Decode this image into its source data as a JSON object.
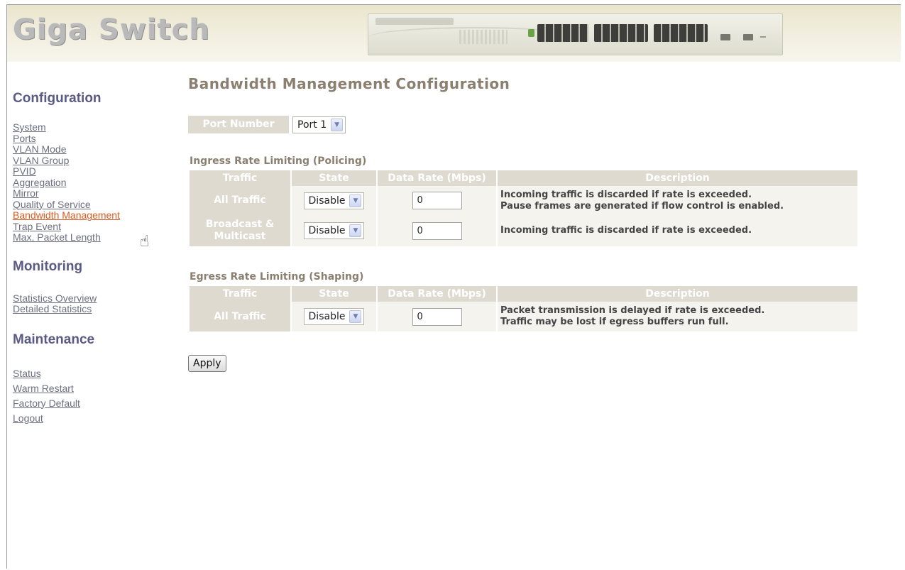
{
  "header": {
    "logo_text": "Giga Switch",
    "device_image": "switch-front-panel"
  },
  "sidebar": {
    "configuration": {
      "heading": "Configuration",
      "items": [
        "System",
        "Ports",
        "VLAN Mode",
        "VLAN Group",
        "PVID",
        "Aggregation",
        "Mirror",
        "Quality of Service",
        "Bandwidth Management",
        "Trap Event",
        "Max. Packet Length"
      ],
      "active_item": "Bandwidth Management"
    },
    "monitoring": {
      "heading": "Monitoring",
      "items": [
        "Statistics Overview",
        "Detailed Statistics"
      ]
    },
    "maintenance": {
      "heading": "Maintenance",
      "items": [
        "Status",
        "Warm Restart",
        "Factory Default",
        "Logout"
      ]
    }
  },
  "main": {
    "title": "Bandwidth Management Configuration",
    "port_number_label": "Port Number",
    "port_selected": "Port 1",
    "columns": {
      "traffic": "Traffic",
      "state": "State",
      "data_rate": "Data Rate (Mbps)",
      "description": "Description"
    },
    "ingress": {
      "heading": "Ingress Rate Limiting (Policing)",
      "rows": [
        {
          "traffic": "All Traffic",
          "state": "Disable",
          "rate": "0",
          "desc_line1": "Incoming traffic is discarded if rate is exceeded.",
          "desc_line2": "Pause frames are generated if flow control is enabled."
        },
        {
          "traffic_line1": "Broadcast &",
          "traffic_line2": "Multicast",
          "state": "Disable",
          "rate": "0",
          "desc_line1": "Incoming traffic is discarded if rate is exceeded."
        }
      ]
    },
    "egress": {
      "heading": "Egress Rate Limiting (Shaping)",
      "rows": [
        {
          "traffic": "All Traffic",
          "state": "Disable",
          "rate": "0",
          "desc_line1": "Packet transmission is delayed if rate is exceeded.",
          "desc_line2": "Traffic may be lost if egress buffers run full."
        }
      ]
    },
    "apply_label": "Apply"
  },
  "colors": {
    "heading": "#5a5a85",
    "link": "#6e6e82",
    "active_link": "#d95a22",
    "title": "#8b7f70",
    "table_header": "#dedad0"
  }
}
